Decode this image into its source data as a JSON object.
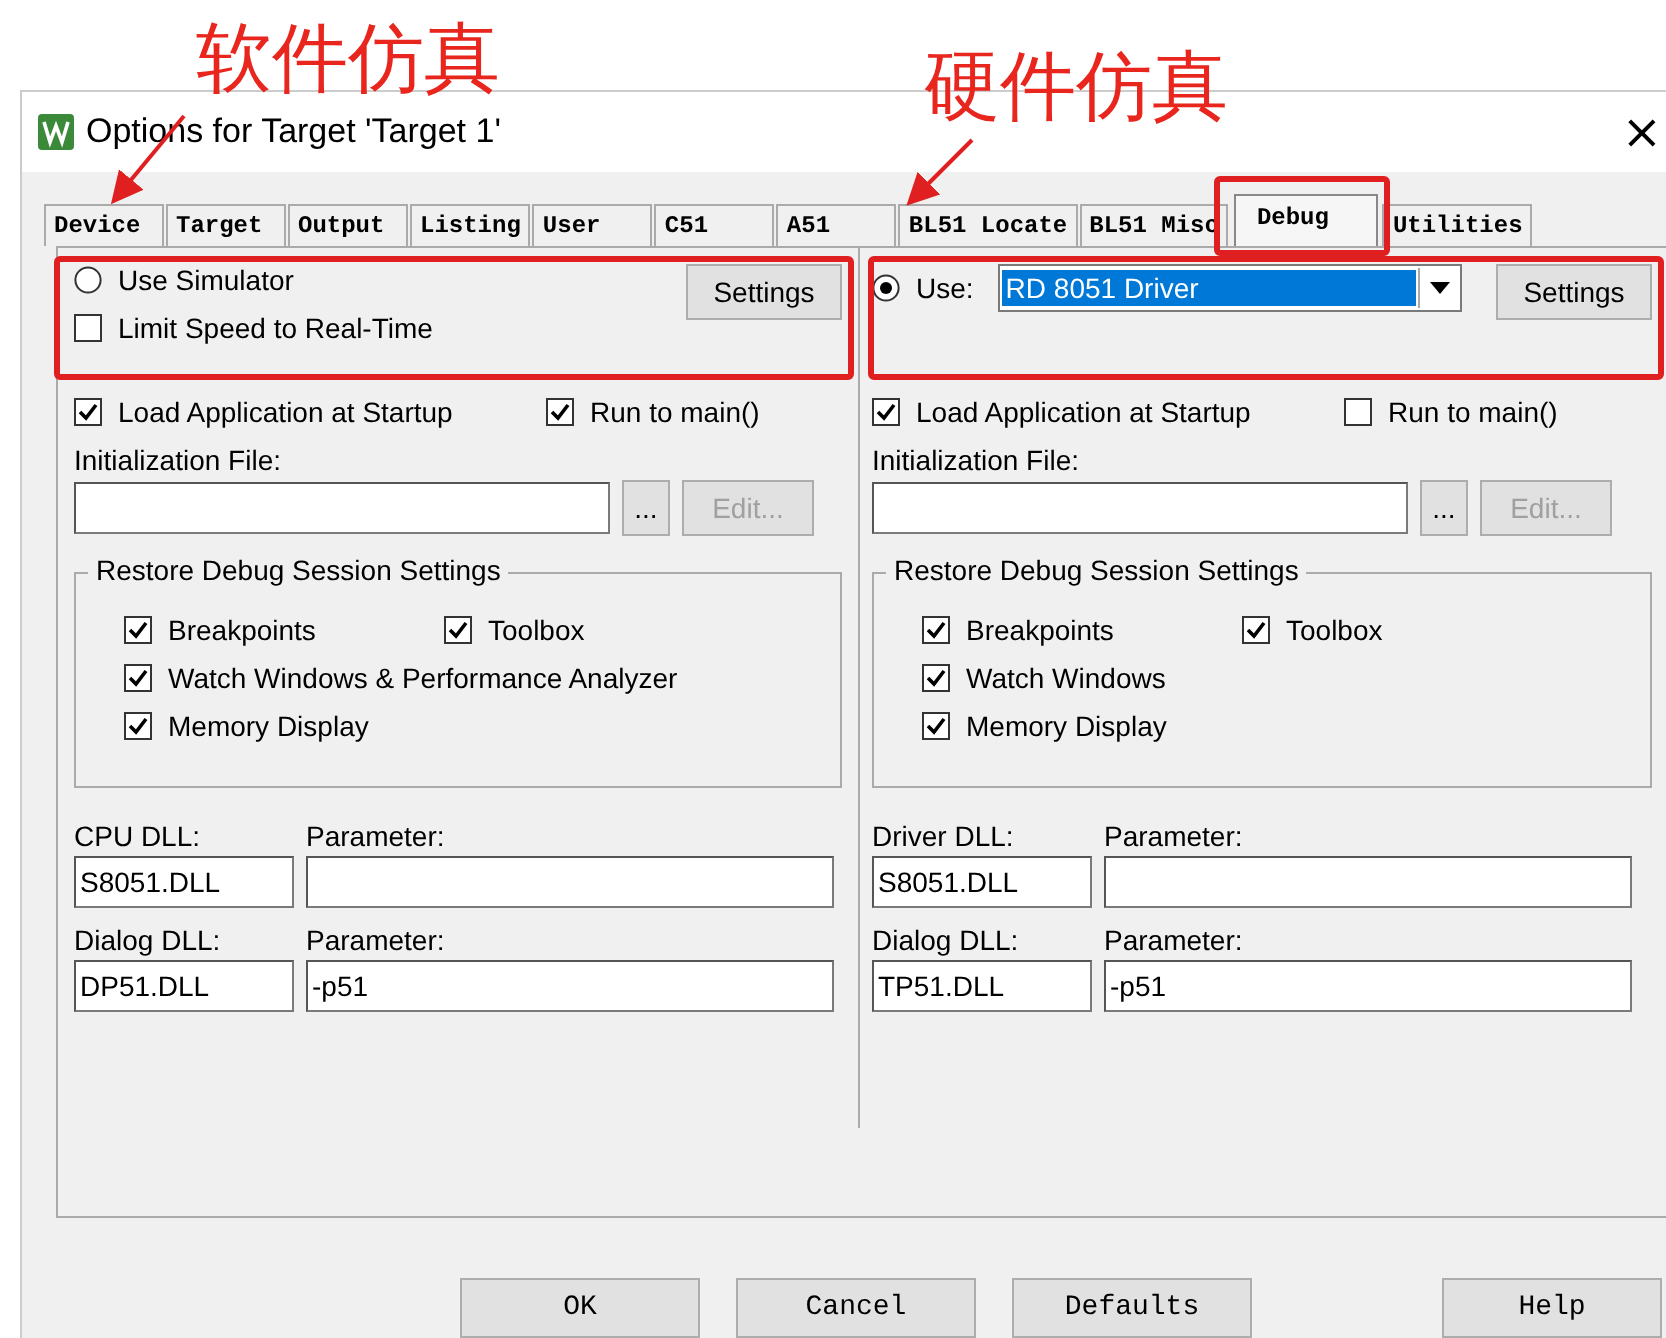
{
  "annotations": [
    {
      "text": "软件仿真"
    },
    {
      "text": "硬件仿真"
    }
  ],
  "window": {
    "title": "Options for Target 'Target 1'",
    "close": "×"
  },
  "tabs": [
    {
      "label": "Device",
      "selected": false
    },
    {
      "label": "Target",
      "selected": false
    },
    {
      "label": "Output",
      "selected": false
    },
    {
      "label": "Listing",
      "selected": false
    },
    {
      "label": "User",
      "selected": false
    },
    {
      "label": "C51",
      "selected": false
    },
    {
      "label": "A51",
      "selected": false
    },
    {
      "label": "BL51 Locate",
      "selected": false
    },
    {
      "label": "BL51 Misc",
      "selected": false
    },
    {
      "label": "Debug",
      "selected": true
    },
    {
      "label": "Utilities",
      "selected": false
    }
  ],
  "columns": [
    {
      "top": {
        "kind": "simulator",
        "radio": {
          "label": "Use Simulator",
          "selected": false
        },
        "checkbox": {
          "label": "Limit Speed to Real-Time",
          "checked": false
        },
        "button": "Settings"
      },
      "startup": [
        {
          "label": "Load Application at Startup",
          "checked": true
        },
        {
          "label": "Run to main()",
          "checked": true
        }
      ],
      "init_file": {
        "label": "Initialization File:",
        "browse": "...",
        "edit": {
          "label": "Edit...",
          "disabled": true
        }
      },
      "restore": {
        "title": "Restore Debug Session Settings",
        "options": [
          {
            "label": "Breakpoints",
            "checked": true
          },
          {
            "label": "Toolbox",
            "checked": true
          },
          {
            "label": "Watch Windows & Performance Analyzer",
            "checked": true
          },
          {
            "label": "Memory Display",
            "checked": true
          }
        ]
      },
      "dlls": [
        {
          "label": "CPU DLL:",
          "value": "S8051.DLL",
          "param_label": "Parameter:"
        },
        {
          "label": "Dialog DLL:",
          "value": "DP51.DLL",
          "param_label": "Parameter:",
          "param": "-p51"
        }
      ]
    },
    {
      "top": {
        "kind": "driver",
        "radio": {
          "label": "Use:",
          "selected": true
        },
        "dropdown": {
          "value": "RD 8051 Driver"
        },
        "button": "Settings"
      },
      "startup": [
        {
          "label": "Load Application at Startup",
          "checked": true
        },
        {
          "label": "Run to main()",
          "checked": false
        }
      ],
      "init_file": {
        "label": "Initialization File:",
        "browse": "...",
        "edit": {
          "label": "Edit...",
          "disabled": true
        }
      },
      "restore": {
        "title": "Restore Debug Session Settings",
        "options": [
          {
            "label": "Breakpoints",
            "checked": true
          },
          {
            "label": "Toolbox",
            "checked": true
          },
          {
            "label": "Watch Windows",
            "checked": true
          },
          {
            "label": "Memory Display",
            "checked": true
          }
        ]
      },
      "dlls": [
        {
          "label": "Driver DLL:",
          "value": "S8051.DLL",
          "param_label": "Parameter:"
        },
        {
          "label": "Dialog DLL:",
          "value": "TP51.DLL",
          "param_label": "Parameter:",
          "param": "-p51"
        }
      ]
    }
  ],
  "buttons": [
    "OK",
    "Cancel",
    "Defaults",
    "Help"
  ]
}
